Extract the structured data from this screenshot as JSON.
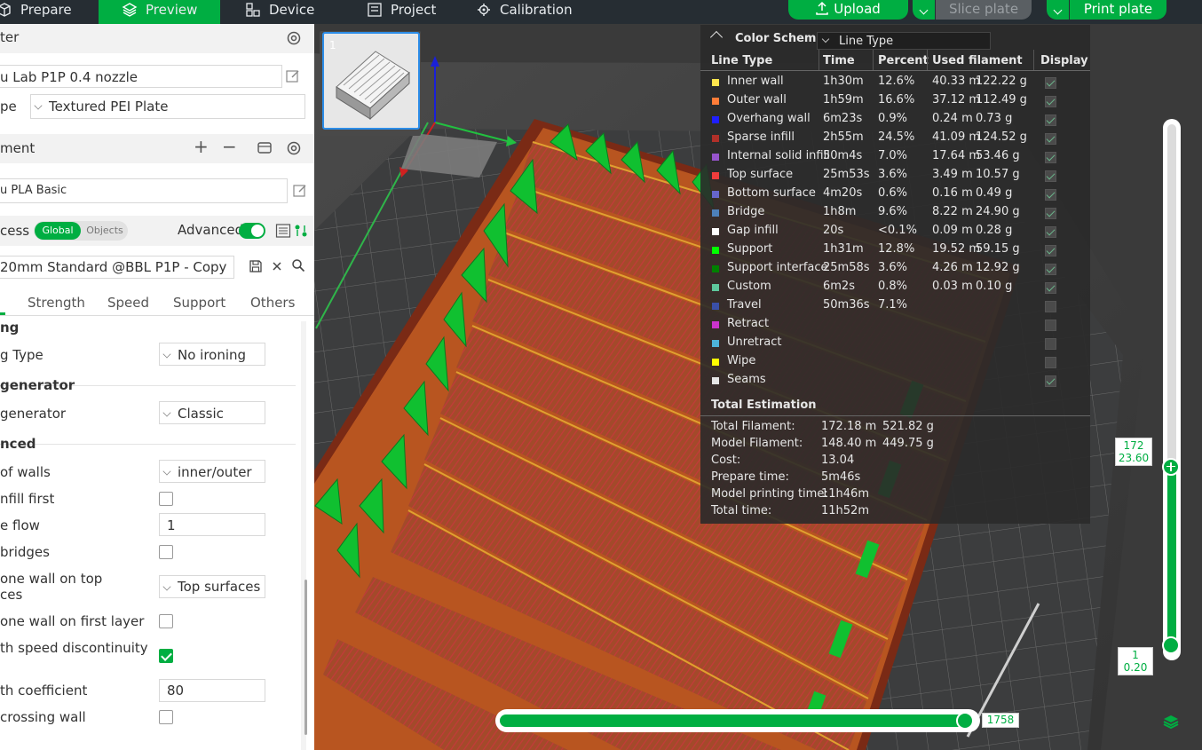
{
  "topbar": {
    "tabs": [
      {
        "label": "Prepare",
        "icon": "cube-icon"
      },
      {
        "label": "Preview",
        "icon": "layers-icon"
      },
      {
        "label": "Device",
        "icon": "device-icon"
      },
      {
        "label": "Project",
        "icon": "project-icon"
      },
      {
        "label": "Calibration",
        "icon": "calibration-icon"
      }
    ],
    "upload_label": "Upload",
    "slice_label": "Slice plate",
    "print_label": "Print plate"
  },
  "left": {
    "printer_header": "ter",
    "printer_name": "u Lab P1P 0.4 nozzle",
    "plate_label": "pe",
    "plate_value": "Textured PEI Plate",
    "filament_header": "ment",
    "filament_value": "u PLA Basic",
    "process_label": "cess",
    "toggle_global": "Global",
    "toggle_objects": "Objects",
    "advanced_label": "Advanced",
    "process_profile": "20mm Standard @BBL P1P - Copy",
    "tabs": [
      "Strength",
      "Speed",
      "Support",
      "Others"
    ],
    "settings": {
      "ironing_group": "ng",
      "ironing_type_label": "g Type",
      "ironing_type_value": "No ironing",
      "wallgen_group": "generator",
      "wallgen_label": "generator",
      "wallgen_value": "Classic",
      "advanced_group": "nced",
      "order_walls_label": " of walls",
      "order_walls_value": "inner/outer",
      "infill_first_label": "nfill first",
      "flow_label": "e flow",
      "flow_value": "1",
      "bridges_label": "bridges",
      "one_wall_top_label_1": "one wall on top",
      "one_wall_top_label_2": "ces",
      "one_wall_top_value": "Top surfaces",
      "one_wall_first_label": "one wall on first layer",
      "speed_disc_label": "th speed discontinuity",
      "coeff_label": "th coefficient",
      "coeff_value": "80",
      "crossing_label": " crossing wall"
    }
  },
  "plate_number": "1",
  "legend": {
    "title": "Color Scheme",
    "scheme": "Line Type",
    "headers": [
      "Line Type",
      "Time",
      "Percent",
      "Used filament",
      "Display"
    ],
    "rows": [
      {
        "name": "Inner wall",
        "color": "#ffe54d",
        "time": "1h30m",
        "percent": "12.6%",
        "len": "40.33 m",
        "weight": "122.22 g",
        "display": true
      },
      {
        "name": "Outer wall",
        "color": "#ff7d38",
        "time": "1h59m",
        "percent": "16.6%",
        "len": "37.12 m",
        "weight": "112.49 g",
        "display": true
      },
      {
        "name": "Overhang wall",
        "color": "#1f1fff",
        "time": "6m23s",
        "percent": "0.9%",
        "len": "0.24 m",
        "weight": "0.73 g",
        "display": true
      },
      {
        "name": "Sparse infill",
        "color": "#b03029",
        "time": "2h55m",
        "percent": "24.5%",
        "len": "41.09 m",
        "weight": "124.52 g",
        "display": true
      },
      {
        "name": "Internal solid infill",
        "color": "#9654cc",
        "time": "50m4s",
        "percent": "7.0%",
        "len": "17.64 m",
        "weight": "53.46 g",
        "display": true
      },
      {
        "name": "Top surface",
        "color": "#f03c3c",
        "time": "25m53s",
        "percent": "3.6%",
        "len": "3.49 m",
        "weight": "10.57 g",
        "display": true
      },
      {
        "name": "Bottom surface",
        "color": "#6666cc",
        "time": "4m20s",
        "percent": "0.6%",
        "len": "0.16 m",
        "weight": "0.49 g",
        "display": true
      },
      {
        "name": "Bridge",
        "color": "#4d80ba",
        "time": "1h8m",
        "percent": "9.6%",
        "len": "8.22 m",
        "weight": "24.90 g",
        "display": true
      },
      {
        "name": "Gap infill",
        "color": "#ffffff",
        "time": "20s",
        "percent": "<0.1%",
        "len": "0.09 m",
        "weight": "0.28 g",
        "display": true
      },
      {
        "name": "Support",
        "color": "#00ff00",
        "time": "1h31m",
        "percent": "12.8%",
        "len": "19.52 m",
        "weight": "59.15 g",
        "display": true
      },
      {
        "name": "Support interface",
        "color": "#008000",
        "time": "25m58s",
        "percent": "3.6%",
        "len": "4.26 m",
        "weight": "12.92 g",
        "display": true
      },
      {
        "name": "Custom",
        "color": "#5ec79c",
        "time": "6m2s",
        "percent": "0.8%",
        "len": "0.03 m",
        "weight": "0.10 g",
        "display": true
      },
      {
        "name": "Travel",
        "color": "#3a4fa8",
        "time": "50m36s",
        "percent": "7.1%",
        "len": "",
        "weight": "",
        "display": false
      },
      {
        "name": "Retract",
        "color": "#cc33cc",
        "time": "",
        "percent": "",
        "len": "",
        "weight": "",
        "display": false
      },
      {
        "name": "Unretract",
        "color": "#4db3d9",
        "time": "",
        "percent": "",
        "len": "",
        "weight": "",
        "display": false
      },
      {
        "name": "Wipe",
        "color": "#ffff00",
        "time": "",
        "percent": "",
        "len": "",
        "weight": "",
        "display": false
      },
      {
        "name": "Seams",
        "color": "#e6e6e6",
        "time": "",
        "percent": "",
        "len": "",
        "weight": "",
        "display": true
      }
    ],
    "total_title": "Total Estimation",
    "totals": [
      {
        "label": "Total Filament:",
        "v1": "172.18 m",
        "v2": "521.82 g"
      },
      {
        "label": "Model Filament:",
        "v1": "148.40 m",
        "v2": "449.75 g"
      },
      {
        "label": "Cost:",
        "v1": "13.04",
        "v2": ""
      },
      {
        "label": "Prepare time:",
        "v1": "5m46s",
        "v2": ""
      },
      {
        "label": "Model printing time:",
        "v1": "11h46m",
        "v2": ""
      },
      {
        "label": "Total time:",
        "v1": "11h52m",
        "v2": ""
      }
    ]
  },
  "slider": {
    "top_layer": "172",
    "top_height": "23.60",
    "bottom_layer": "1",
    "bottom_height": "0.20",
    "move_value": "1758"
  }
}
